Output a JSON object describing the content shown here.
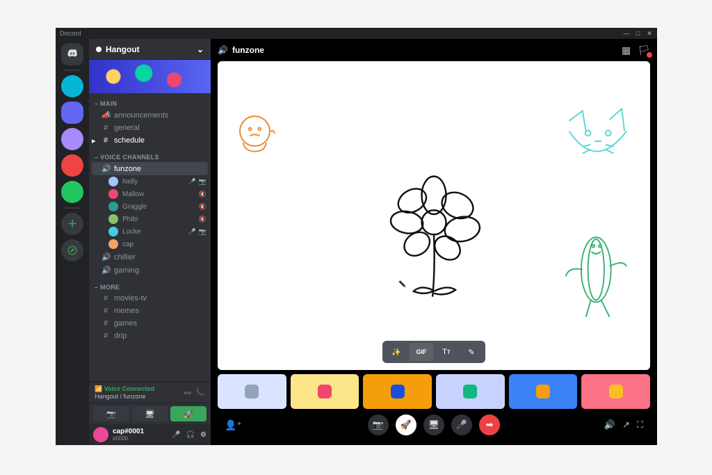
{
  "app_name": "Discord",
  "server_name": "Hangout",
  "sections": {
    "main_label": "MAIN",
    "voice_label": "VOICE CHANNELS",
    "more_label": "MORE"
  },
  "text_channels_main": [
    {
      "icon": "megaphone",
      "name": "announcements"
    },
    {
      "icon": "hash",
      "name": "general"
    },
    {
      "icon": "hash",
      "name": "schedule",
      "unread": true
    }
  ],
  "voice_channels": [
    {
      "name": "funzone",
      "active": true,
      "members": [
        {
          "name": "Nelly",
          "color": "#a0c4ff",
          "mic": true,
          "cam": true
        },
        {
          "name": "Mallow",
          "color": "#ef476f",
          "mic_muted": true
        },
        {
          "name": "Graggle",
          "color": "#2a9d8f",
          "mic_muted": true
        },
        {
          "name": "Phibi",
          "color": "#90be6d",
          "mic_muted": true
        },
        {
          "name": "Locke",
          "color": "#48cae4",
          "mic": true,
          "cam": true
        },
        {
          "name": "cap",
          "color": "#f4a261"
        }
      ]
    },
    {
      "name": "chillier"
    },
    {
      "name": "gaming"
    }
  ],
  "text_channels_more": [
    {
      "name": "movies-tv"
    },
    {
      "name": "memes"
    },
    {
      "name": "games"
    },
    {
      "name": "drip"
    }
  ],
  "voice_status": {
    "title": "Voice Connected",
    "subtitle": "Hangout / funzone"
  },
  "current_user": {
    "name": "cap#0001",
    "tag": "#0000"
  },
  "channel_header": {
    "name": "funzone"
  },
  "whiteboard_tools": {
    "magic": "✨",
    "gif": "GIF",
    "text": "Tᴛ",
    "pen": "✎"
  },
  "participant_tiles": [
    {
      "bg": "#dbe4ff",
      "av": "#94a3b8"
    },
    {
      "bg": "#fde68a",
      "av": "#ef476f"
    },
    {
      "bg": "#f59e0b",
      "av": "#1d4ed8"
    },
    {
      "bg": "#c7d2fe",
      "av": "#10b981"
    },
    {
      "bg": "#3b82f6",
      "av": "#f59e0b"
    },
    {
      "bg": "#fb7185",
      "av": "#fbbf24"
    }
  ],
  "server_rail": [
    {
      "type": "home"
    },
    {
      "color": "#06b6d4"
    },
    {
      "color": "#6366f1",
      "selected": true
    },
    {
      "color": "#a78bfa"
    },
    {
      "color": "#ef4444"
    },
    {
      "color": "#22c55e"
    },
    {
      "type": "divider"
    },
    {
      "type": "add"
    },
    {
      "type": "explore"
    }
  ]
}
